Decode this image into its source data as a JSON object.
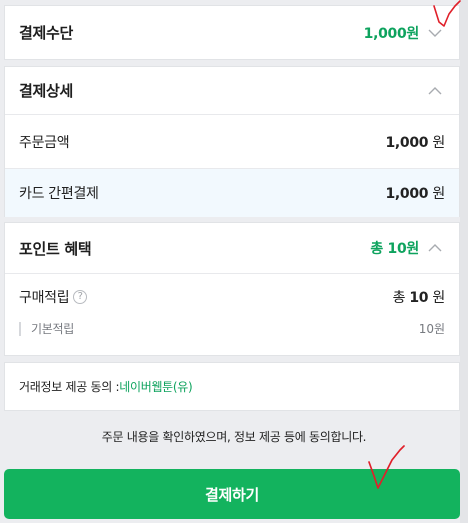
{
  "payment_method": {
    "title": "결제수단",
    "amount": "1,000원"
  },
  "payment_detail": {
    "title": "결제상세",
    "rows": [
      {
        "label": "주문금액",
        "amount": "1,000",
        "unit": "원"
      },
      {
        "label": "카드 간편결제",
        "amount": "1,000",
        "unit": "원"
      }
    ]
  },
  "point_benefit": {
    "title": "포인트 혜택",
    "total": "총 10원",
    "purchase_label": "구매적립",
    "purchase_prefix": "총",
    "purchase_amount": "10",
    "purchase_unit": "원",
    "basic_label": "기본적립",
    "basic_amount": "10원"
  },
  "consent": {
    "prefix": "거래정보 제공 동의 : ",
    "provider": "네이버웹툰(유)"
  },
  "agree_text": "주문 내용을 확인하였으며, 정보 제공 등에 동의합니다.",
  "pay_button_label": "결제하기",
  "colors": {
    "accent_green": "#0ea35e",
    "button_green": "#13b35e",
    "highlight_row": "#f2f9fe",
    "annotation_red": "#e0202a"
  },
  "icons": {
    "chevron_down": "chevron-down-icon",
    "chevron_up": "chevron-up-icon",
    "info": "info-icon"
  }
}
